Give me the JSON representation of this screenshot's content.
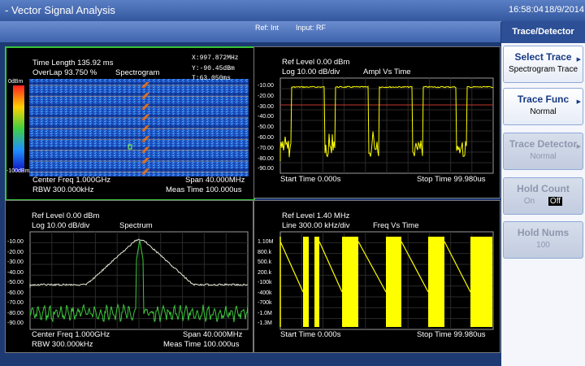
{
  "title": "- Vector Signal Analysis",
  "time": "16:58:04",
  "date": "18/9/2014",
  "status": {
    "ref": "Ref: Int",
    "input": "Input: RF"
  },
  "panel": {
    "header": "Trace/Detector",
    "keys": [
      {
        "label": "Select Trace",
        "value": "Spectrogram Trace",
        "enabled": true
      },
      {
        "label": "Trace Func",
        "value": "Normal",
        "enabled": true
      },
      {
        "label": "Trace Detector",
        "value": "Normal",
        "enabled": false
      },
      {
        "label": "Hold Count",
        "option_on": "On",
        "option_off": "Off",
        "enabled": false
      },
      {
        "label": "Hold Nums",
        "value": "100",
        "enabled": false
      }
    ]
  },
  "spectrogram": {
    "time_length": "Time Length 135.92 ms",
    "overlap": "OverLap 93.750 %",
    "mode": "Spectrogram",
    "marker_x": "X:997.872MHz",
    "marker_y": "Y:-90.45dBm",
    "marker_t": "T:63.050ms",
    "scale_top": "0dBm",
    "scale_bottom": "-100dBm",
    "center": "Center Freq 1.000GHz",
    "span": "Span 40.000MHz",
    "rbw": "RBW 300.000kHz",
    "meas_time": "Meas Time 100.000us"
  },
  "ampl_time": {
    "ref": "Ref Level 0.00 dBm",
    "scale": "Log 10.00 dB/div",
    "mode": "Ampl Vs Time",
    "yticks": [
      "-10.00",
      "-20.00",
      "-30.00",
      "-40.00",
      "-50.00",
      "-60.00",
      "-70.00",
      "-80.00",
      "-90.00"
    ],
    "start": "Start Time 0.000s",
    "stop": "Stop Time 99.980us"
  },
  "spectrum": {
    "ref": "Ref Level 0.00 dBm",
    "scale": "Log 10.00 dB/div",
    "mode": "Spectrum",
    "yticks": [
      "-10.00",
      "-20.00",
      "-30.00",
      "-40.00",
      "-50.00",
      "-60.00",
      "-70.00",
      "-80.00",
      "-90.00"
    ],
    "center": "Center Freq 1.000GHz",
    "span": "Span 40.000MHz",
    "rbw": "RBW 300.000kHz",
    "meas_time": "Meas Time 100.000us"
  },
  "freq_time": {
    "ref": "Ref Level 1.40 MHz",
    "scale": "Line 300.00 kHz/div",
    "mode": "Freq Vs Time",
    "yticks": [
      "1.10M",
      "800.k",
      "500.k",
      "200.k",
      "-100k",
      "-400k",
      "-700k",
      "-1.0M",
      "-1.3M"
    ],
    "start": "Start Time 0.000s",
    "stop": "Stop Time 99.980us"
  },
  "colors": {
    "trace_yellow": "#ffff00",
    "trace_green": "#3ec93e",
    "selected_border": "#39c53c",
    "ref_line": "#c0392b"
  }
}
